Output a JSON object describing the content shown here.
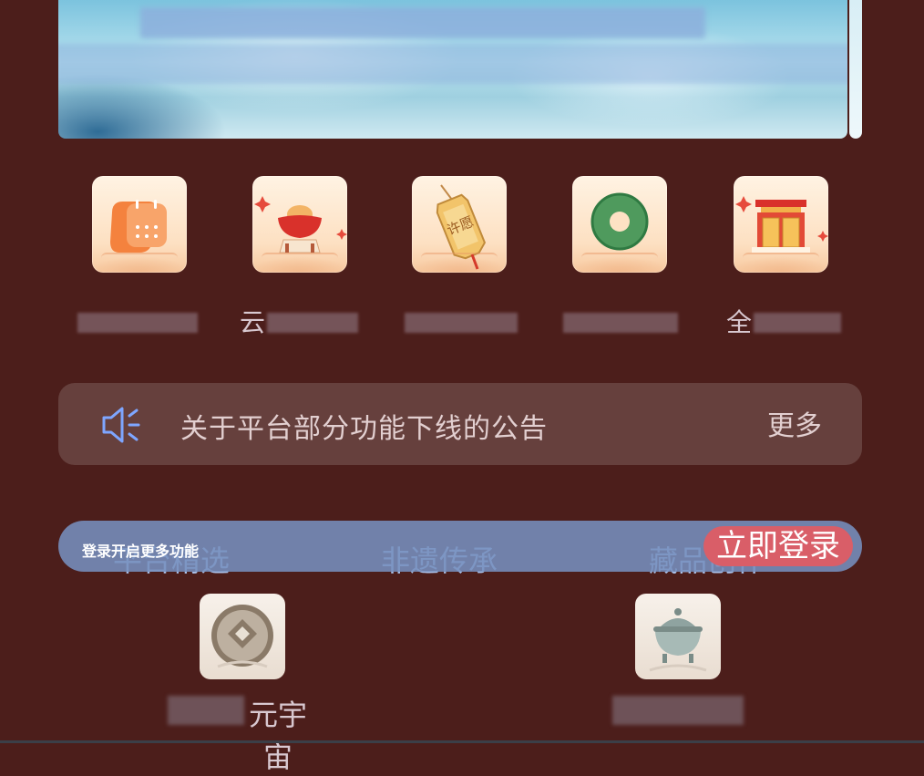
{
  "banner": {},
  "quick_menu": {
    "items": [
      {
        "icon": "calendar-icon",
        "visible_char": ""
      },
      {
        "icon": "treasure-bowl-icon",
        "visible_char": "云"
      },
      {
        "icon": "wish-tablet-icon",
        "visible_char": ""
      },
      {
        "icon": "jade-disc-icon",
        "visible_char": ""
      },
      {
        "icon": "gate-icon",
        "visible_char": "全"
      }
    ],
    "wish_tablet_text": "许愿"
  },
  "notice": {
    "text": "关于平台部分功能下线的公告",
    "more_label": "更多"
  },
  "tabs": [
    "平台精选",
    "非遗传承",
    "藏品创作"
  ],
  "login_bar": {
    "hint": "登录开启更多功能",
    "button_label": "立即登录"
  },
  "cards": [
    {
      "icon": "emblem-coin-icon",
      "visible_text": "元宇宙"
    },
    {
      "icon": "incense-burner-icon",
      "visible_text": ""
    }
  ],
  "colors": {
    "background": "#4c1e1b",
    "notice_bg": "#66403d",
    "login_bar_bg": "#7690be",
    "login_button": "#d95e68",
    "tab_text": "#a9c0e8"
  }
}
